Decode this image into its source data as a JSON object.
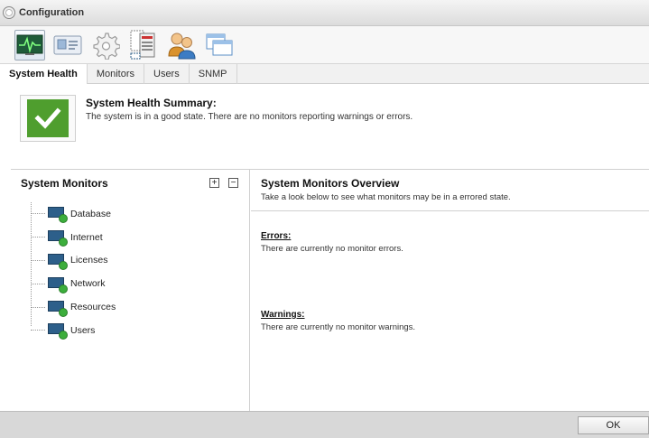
{
  "window": {
    "title": "Configuration"
  },
  "toolbar": {
    "icons": [
      "system-health-icon",
      "monitors-icon",
      "settings-icon",
      "server-config-icon",
      "users-icon",
      "windows-icon"
    ]
  },
  "tabs": [
    {
      "label": "System Health",
      "active": true
    },
    {
      "label": "Monitors",
      "active": false
    },
    {
      "label": "Users",
      "active": false
    },
    {
      "label": "SNMP",
      "active": false
    }
  ],
  "summary": {
    "title": "System Health Summary:",
    "text": "The system is in a good state. There are no monitors reporting warnings or errors."
  },
  "monitors": {
    "title": "System Monitors",
    "expand_label": "+",
    "collapse_label": "−",
    "items": [
      {
        "label": "Database"
      },
      {
        "label": "Internet"
      },
      {
        "label": "Licenses"
      },
      {
        "label": "Network"
      },
      {
        "label": "Resources"
      },
      {
        "label": "Users"
      }
    ]
  },
  "overview": {
    "title": "System Monitors Overview",
    "subtitle": "Take a look below to see what monitors may be in a errored state.",
    "errors_heading": "Errors:",
    "errors_text": "There are currently no monitor errors.",
    "warnings_heading": "Warnings:",
    "warnings_text": "There are currently no monitor warnings."
  },
  "footer": {
    "ok_label": "OK"
  },
  "colors": {
    "status_ok": "#4f9e2e",
    "accent": "#2d5f8a"
  }
}
